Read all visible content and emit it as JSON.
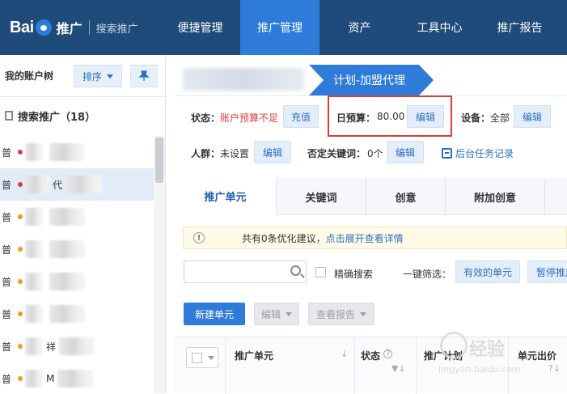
{
  "topbar": {
    "logo_text": "Bai",
    "logo_paw_text": "du",
    "logo_title": "推广",
    "logo_sub": "搜索推广",
    "nav": [
      {
        "label": "便捷管理",
        "active": false
      },
      {
        "label": "推广管理",
        "active": true
      },
      {
        "label": "资产",
        "active": false
      },
      {
        "label": "工具中心",
        "active": false
      },
      {
        "label": "推广报告",
        "active": false
      }
    ]
  },
  "sidebar": {
    "title": "我的账户树",
    "sort_label": "排序",
    "pin_icon": "pin-icon",
    "group_label": "搜索推广（18）",
    "rows": [
      {
        "tag": "普",
        "dot": "#e4393c",
        "selected": false,
        "text": ""
      },
      {
        "tag": "普",
        "dot": "#e4393c",
        "selected": true,
        "text": "代"
      },
      {
        "tag": "普",
        "dot": "#f39c12",
        "selected": false,
        "text": ""
      },
      {
        "tag": "普",
        "dot": "#f39c12",
        "selected": false,
        "text": ""
      },
      {
        "tag": "普",
        "dot": "#f39c12",
        "selected": false,
        "text": ""
      },
      {
        "tag": "普",
        "dot": "#f39c12",
        "selected": false,
        "text": ""
      },
      {
        "tag": "普",
        "dot": "#f39c12",
        "selected": false,
        "text": "祥"
      },
      {
        "tag": "普",
        "dot": "#f39c12",
        "selected": false,
        "text": "M"
      }
    ]
  },
  "plan": {
    "title": "计划-加盟代理",
    "status_label": "状态：",
    "status_value": "账户预算不足",
    "recharge_label": "充值",
    "budget_label": "日预算：",
    "budget_value": "80.00",
    "edit_label": "编辑",
    "device_label": "设备：",
    "device_value": "全部",
    "audience_label": "人群：",
    "audience_value": "未设置",
    "negative_label": "否定关键词：",
    "negative_value": "0个",
    "task_log_label": "后台任务记录"
  },
  "tabs": [
    {
      "label": "推广单元",
      "active": true
    },
    {
      "label": "关键词",
      "active": false
    },
    {
      "label": "创意",
      "active": false
    },
    {
      "label": "附加创意",
      "active": false
    }
  ],
  "notice": {
    "text": "共有0条优化建议，",
    "link": "点击展开查看详情"
  },
  "filters": {
    "search_placeholder": "",
    "exact_search_label": "精确搜索",
    "quick_filter_label": "一键筛选：",
    "valid_units_label": "有效的单元",
    "paused_label": "暂停推广"
  },
  "toolbar": {
    "new_unit_label": "新建单元",
    "edit_label": "编辑",
    "report_label": "查看报告"
  },
  "table": {
    "columns": [
      "推广单元",
      "状态",
      "推广计划",
      "单元出价"
    ]
  },
  "watermark": {
    "title": "经验",
    "url": "jingyan.baidu.com"
  },
  "colors": {
    "topbar": "#1e4b7a",
    "accent": "#2f7bd9",
    "link": "#2f6fbf",
    "warning": "#e4393c",
    "highlight_box": "#e23a36"
  }
}
